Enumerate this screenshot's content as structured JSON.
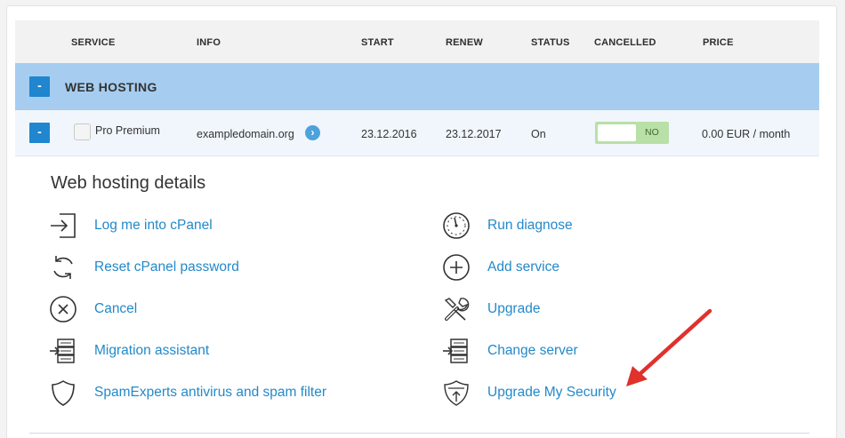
{
  "table": {
    "headers": {
      "service": "SERVICE",
      "info": "INFO",
      "start": "START",
      "renew": "RENEW",
      "status": "STATUS",
      "cancelled": "CANCELLED",
      "price": "PRICE"
    },
    "group": {
      "toggle": "-",
      "title": "WEB HOSTING"
    },
    "row": {
      "toggle": "-",
      "service": "Pro Premium",
      "info": "exampledomain.org",
      "start": "23.12.2016",
      "renew": "23.12.2017",
      "status": "On",
      "cancelled": "NO",
      "price": "0.00 EUR / month"
    }
  },
  "details": {
    "title": "Web hosting details",
    "left_actions": [
      {
        "label": "Log me into cPanel",
        "icon": "login-icon"
      },
      {
        "label": "Reset cPanel password",
        "icon": "refresh-icon"
      },
      {
        "label": "Cancel",
        "icon": "cancel-circle-icon"
      },
      {
        "label": "Migration assistant",
        "icon": "server-migrate-icon"
      },
      {
        "label": "SpamExperts antivirus and spam filter",
        "icon": "shield-icon"
      }
    ],
    "right_actions": [
      {
        "label": "Run diagnose",
        "icon": "gauge-icon"
      },
      {
        "label": "Add service",
        "icon": "add-circle-icon"
      },
      {
        "label": "Upgrade",
        "icon": "tools-icon"
      },
      {
        "label": "Change server",
        "icon": "server-change-icon"
      },
      {
        "label": "Upgrade My Security",
        "icon": "security-shield-icon"
      }
    ]
  },
  "colors": {
    "accent": "#1f86cf",
    "link": "#2389c9",
    "group_bg": "#a6cdf0",
    "row_bg": "#f0f6fc",
    "switch_bg": "#b8e0a7",
    "annotation_arrow": "#e0312d"
  }
}
